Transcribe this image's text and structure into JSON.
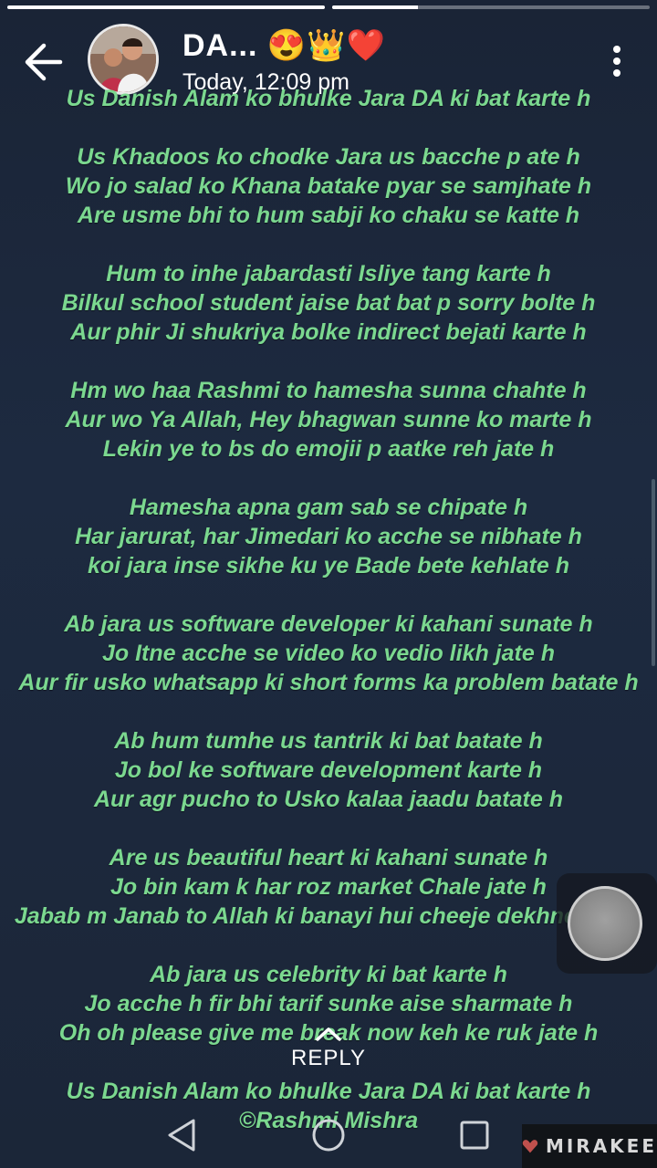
{
  "status": {
    "progress_segments": [
      1.0,
      0.27
    ]
  },
  "header": {
    "title": "DA... 😍👑❤️",
    "time": "Today, 12:09 pm",
    "back_icon": "arrow-back-icon",
    "menu_icon": "more-vertical-icon"
  },
  "poem": {
    "lines": [
      "Us Danish Alam ko bhulke Jara DA ki bat karte h",
      "",
      "Us Khadoos ko chodke Jara us bacche p ate h",
      "Wo jo salad ko Khana batake pyar se samjhate h",
      "Are usme bhi to hum sabji ko chaku se katte h",
      "",
      "Hum to inhe jabardasti Isliye tang karte h",
      "Bilkul school student jaise bat bat p sorry bolte h",
      "Aur phir Ji shukriya bolke indirect bejati karte h",
      "",
      "Hm wo haa Rashmi to hamesha sunna chahte h",
      "Aur wo Ya Allah, Hey bhagwan sunne ko marte h",
      "Lekin ye to bs do emojii p aatke reh jate h",
      "",
      "Hamesha apna gam sab se chipate h",
      "Har jarurat, har Jimedari ko acche se nibhate h",
      "koi jara inse sikhe ku ye Bade bete kehlate h",
      "",
      "Ab jara us software developer ki kahani sunate h",
      "Jo Itne acche se video ko vedio likh jate h",
      "Aur fir usko whatsapp ki short forms ka problem batate h",
      "",
      "Ab hum tumhe us tantrik ki bat batate h",
      "Jo bol ke software development karte h",
      "Aur agr pucho to Usko kalaa jaadu batate h",
      "",
      "Are us beautiful heart ki kahani sunate h",
      "Jo bin kam k har roz market Chale jate h",
      "Jabab m Janab to Allah ki banayi hui cheeje dekhne jate h",
      "",
      "Ab jara us celebrity ki bat karte h",
      "Jo acche h fir bhi tarif sunke aise sharmate h",
      "Oh oh please give me break now keh ke ruk jate h",
      "",
      "Us Danish Alam ko bhulke Jara DA ki bat karte h",
      "©Rashmi Mishra"
    ],
    "text_color": "#7bd88f"
  },
  "reply": {
    "label": "REPLY",
    "icon": "chevron-up-icon"
  },
  "navbar": {
    "back_icon": "nav-back-triangle-icon",
    "home_icon": "nav-home-circle-icon",
    "recents_icon": "nav-recents-square-icon"
  },
  "brand": {
    "name": "MIRAKEE",
    "icon": "heart-logo-icon",
    "color": "#c0504d"
  }
}
